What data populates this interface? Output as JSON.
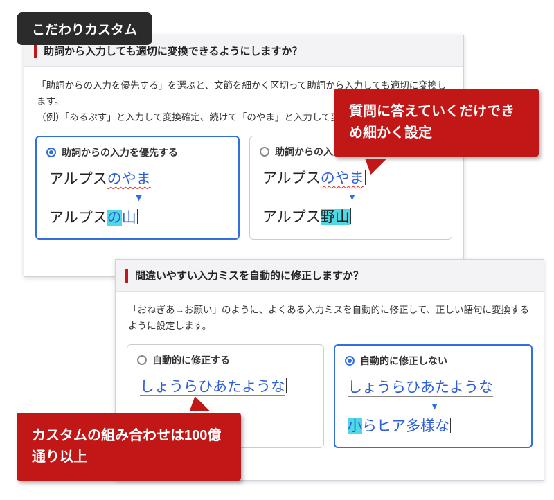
{
  "badge": "こだわりカスタム",
  "bubble1": "質問に答えていくだけできめ細かく設定",
  "bubble2": "カスタムの組み合わせは100億通り以上",
  "panel1": {
    "title": "助詞から入力しても適切に変換できるようにしますか？",
    "desc1": "「助詞からの入力を優先する」を選ぶと、文節を細かく区切って助詞から入力しても適切に変換します。",
    "desc2": "（例）「あるぷす」と入力して変換確定、続けて「のやま」と入力して変換",
    "optA": {
      "label": "助詞からの入力を優先する",
      "line1_black": "アルプス",
      "line1_blue": "のやま",
      "line2_black": "アルプス",
      "line2_blue_hl": "の",
      "line2_blue_rest": "山"
    },
    "optB": {
      "label": "助詞からの入力を優先しない",
      "line1_black": "アルプス",
      "line1_blue": "のやま",
      "line2_black": "アルプス",
      "line2_hl": "野山"
    }
  },
  "panel2": {
    "title": "間違いやすい入力ミスを自動的に修正しますか？",
    "desc": "「おねぎあ→お願い」のように、よくある入力ミスを自動的に修正して、正しい語句に変換するように設定します。",
    "optA": {
      "label": "自動的に修正する",
      "line1": "しょうらひあたような"
    },
    "optB": {
      "label": "自動的に修正しない",
      "line1": "しょうらひあたような",
      "line2_hl": "小",
      "line2_rest": "らヒア多様な"
    }
  }
}
